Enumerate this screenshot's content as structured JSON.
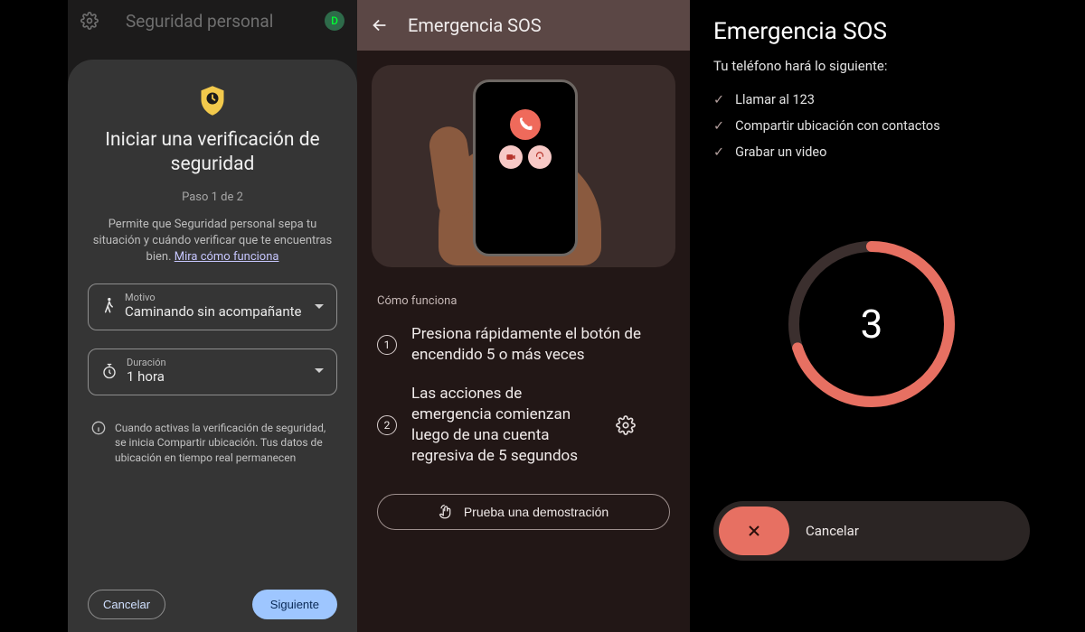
{
  "screen1": {
    "app_title": "Seguridad personal",
    "avatar_initial": "D",
    "heading": "Iniciar una verificación de seguridad",
    "step": "Paso 1 de 2",
    "description_pre": "Permite que Seguridad personal sepa tu situación y cuándo verificar que te encuentras bien. ",
    "description_link": "Mira cómo funciona",
    "field_motivo_label": "Motivo",
    "field_motivo_value": "Caminando sin acompañante",
    "field_duracion_label": "Duración",
    "field_duracion_value": "1 hora",
    "info": "Cuando activas la verificación de seguridad, se inicia Compartir ubicación. Tus datos de ubicación en tiempo real permanecen",
    "cancel": "Cancelar",
    "next": "Siguiente"
  },
  "screen2": {
    "title": "Emergencia SOS",
    "how_header": "Cómo funciona",
    "step1_num": "1",
    "step1": "Presiona rápidamente el botón de encendido 5 o más veces",
    "step2_num": "2",
    "step2": "Las acciones de emergencia comienzan luego de una cuenta regresiva de 5 segundos",
    "demo": "Prueba una demostración"
  },
  "screen3": {
    "title": "Emergencia SOS",
    "subtitle": "Tu teléfono hará lo siguiente:",
    "items": [
      "Llamar al 123",
      "Compartir ubicación con contactos",
      "Grabar un video"
    ],
    "countdown": "3",
    "progress_pct": 70,
    "cancel": "Cancelar"
  },
  "colors": {
    "accent_red": "#e77062",
    "accent_yellow": "#f2c94c",
    "primary_blue": "#9ec6ff"
  }
}
